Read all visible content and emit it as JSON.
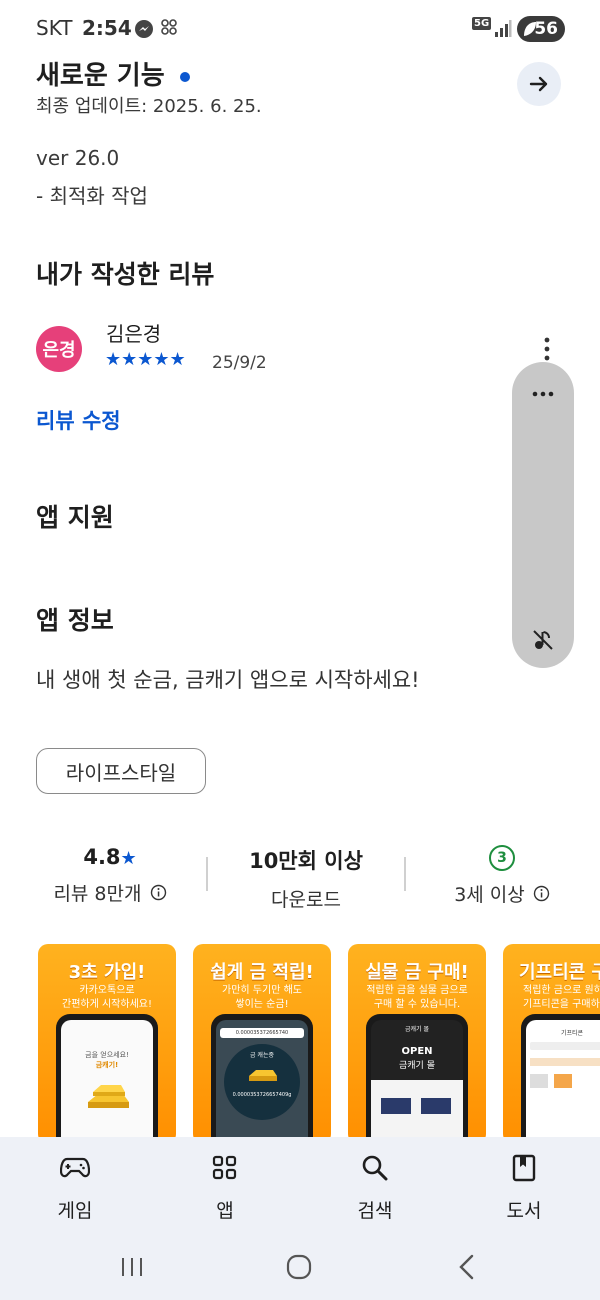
{
  "status_bar": {
    "carrier": "SKT",
    "time": "2:54",
    "network": "5G",
    "battery": "56"
  },
  "whats_new": {
    "title": "새로운 기능",
    "updated": "최종 업데이트: 2025. 6. 25.",
    "version": "ver 26.0",
    "note": "- 최적화 작업"
  },
  "my_review": {
    "section_title": "내가 작성한 리뷰",
    "avatar_text": "은경",
    "reviewer": "김은경",
    "stars": "★★★★★",
    "date": "25/9/2",
    "edit_link": "리뷰 수정"
  },
  "app_support": {
    "title": "앱 지원"
  },
  "app_info": {
    "title": "앱 정보",
    "description": "내 생애 첫 순금, 금캐기 앱으로 시작하세요!",
    "category_chip": "라이프스타일"
  },
  "stats": {
    "rating": "4.8",
    "rating_star": "★",
    "reviews": "리뷰 8만개",
    "downloads": "10만회 이상",
    "downloads_label": "다운로드",
    "age_badge": "3",
    "age_label": "3세 이상"
  },
  "screenshots": [
    {
      "title": "3초 가입!",
      "sub1": "카카오톡으로",
      "sub2": "간편하게 시작하세요!"
    },
    {
      "title": "쉽게 금 적립!",
      "sub1": "가만히 두기만 해도",
      "sub2": "쌓이는 순금!"
    },
    {
      "title": "실물 금 구매!",
      "sub1": "적립한 금을 실물 금으로",
      "sub2": "구매 할 수 있습니다."
    },
    {
      "title": "기프티콘 구",
      "sub1": "적립한 금으로 원하",
      "sub2": "기프티콘을 구매하"
    }
  ],
  "shot_inner": {
    "s1_line1": "금을 얻으세요!",
    "s1_line2": "금캐기!",
    "s2_value": "0.000035372665740",
    "s2_label": "금 캐는중",
    "s2_big": "0.0000353726657409g",
    "s3_open": "OPEN",
    "s3_store": "금캐기 몰",
    "s4_header": "기프티콘"
  },
  "bottom_nav": {
    "items": [
      {
        "label": "게임",
        "icon": "gamepad-icon"
      },
      {
        "label": "앱",
        "icon": "apps-grid-icon"
      },
      {
        "label": "검색",
        "icon": "search-icon"
      },
      {
        "label": "도서",
        "icon": "book-icon"
      }
    ]
  },
  "colors": {
    "accent": "#0b57d0",
    "avatar": "#e6407a",
    "age_badge": "#1e8e3e",
    "shot_orange": "#ff9d0a"
  }
}
